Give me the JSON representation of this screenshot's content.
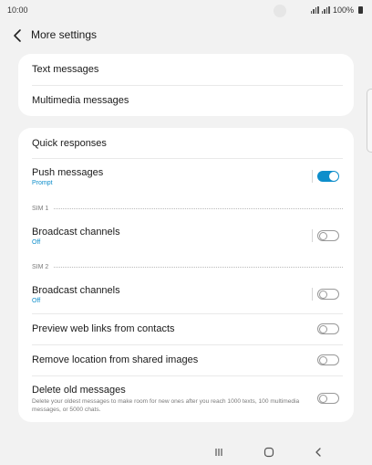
{
  "status_bar": {
    "time": "10:00",
    "battery": "100%"
  },
  "header": {
    "title": "More settings"
  },
  "group1": {
    "items": [
      {
        "label": "Text messages"
      },
      {
        "label": "Multimedia messages"
      }
    ]
  },
  "group2": {
    "quick_responses": {
      "label": "Quick responses"
    },
    "push_messages": {
      "label": "Push messages",
      "status": "Prompt",
      "enabled": true
    },
    "sim1": {
      "label": "SIM 1",
      "broadcast": {
        "label": "Broadcast channels",
        "status": "Off",
        "enabled": false
      }
    },
    "sim2": {
      "label": "SIM 2",
      "broadcast": {
        "label": "Broadcast channels",
        "status": "Off",
        "enabled": false
      }
    },
    "preview_links": {
      "label": "Preview web links from contacts",
      "enabled": false
    },
    "remove_location": {
      "label": "Remove location from shared images",
      "enabled": false
    },
    "delete_old": {
      "label": "Delete old messages",
      "description": "Delete your oldest messages to make room for new ones after you reach 1000 texts, 100 multimedia messages, or 5000 chats.",
      "enabled": false
    }
  },
  "colors": {
    "accent": "#0e8ecb",
    "background": "#f2f2f2",
    "card": "#ffffff"
  },
  "nav": {
    "icons": [
      "recent-apps-icon",
      "home-icon",
      "back-icon"
    ]
  }
}
